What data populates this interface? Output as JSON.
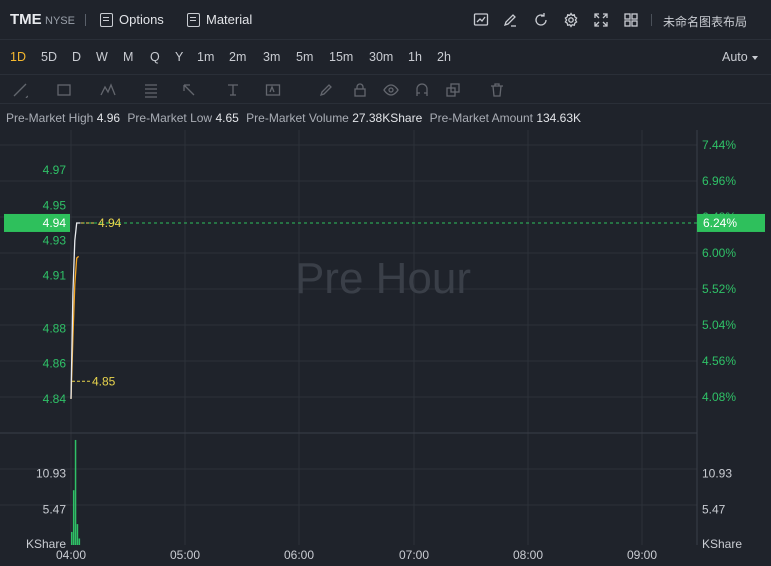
{
  "header": {
    "symbol": "TME",
    "exchange": "NYSE",
    "options_label": "Options",
    "material_label": "Material",
    "layout_name": "未命名图表布局"
  },
  "timeframes": [
    "1D",
    "5D",
    "D",
    "W",
    "M",
    "Q",
    "Y",
    "1m",
    "2m",
    "3m",
    "5m",
    "15m",
    "30m",
    "1h",
    "2h"
  ],
  "active_timeframe": "1D",
  "auto_label": "Auto",
  "icons": {
    "toolbar": [
      "chart-icon",
      "edit-icon",
      "refresh-icon",
      "gear-icon",
      "fullscreen-icon",
      "grid-layout-icon"
    ],
    "drawing": [
      "line-tool-icon",
      "rect-tool-icon",
      "pattern-tool-icon",
      "fib-tool-icon",
      "arrow-tool-icon",
      "measure-tool-icon",
      "text-tool-icon",
      "pencil-icon",
      "lock-icon",
      "eye-icon",
      "magnet-icon",
      "layers-icon",
      "trash-icon"
    ]
  },
  "premarket": {
    "high_label": "Pre-Market High",
    "high": "4.96",
    "low_label": "Pre-Market Low",
    "low": "4.65",
    "volume_label": "Pre-Market Volume",
    "volume": "27.38KShare",
    "amount_label": "Pre-Market Amount",
    "amount": "134.63K"
  },
  "colors": {
    "background": "#1f232b",
    "grid": "#2c313a",
    "up_green": "#2fc167",
    "highlight_green": "#2ec05c",
    "price_line": "#e8eaee",
    "avg_line": "#f5a623",
    "label_yellow": "#e8d44d"
  },
  "chart_data": {
    "type": "line",
    "watermark": "Pre Hour",
    "x_ticks": [
      "04:00",
      "05:00",
      "06:00",
      "07:00",
      "08:00",
      "09:00"
    ],
    "price_axis": {
      "ticks": [
        "4.97",
        "4.95",
        "4.93",
        "4.91",
        "4.88",
        "4.86",
        "4.84"
      ],
      "ylim": [
        4.828,
        4.99
      ]
    },
    "percent_axis": {
      "ticks": [
        "7.44%",
        "6.96%",
        "6.48%",
        "6.00%",
        "5.52%",
        "5.04%",
        "4.56%",
        "4.08%"
      ]
    },
    "current_price": 4.94,
    "current_price_label": "4.94",
    "current_percent_label": "6.24%",
    "low_marker": 4.85,
    "low_marker_label": "4.85",
    "high_marker_label": "4.94",
    "price_series": {
      "x": [
        "04:00",
        "04:01",
        "04:02",
        "04:03",
        "04:04",
        "04:05"
      ],
      "y": [
        4.84,
        4.9,
        4.93,
        4.94,
        4.94,
        4.94
      ]
    },
    "avg_series": {
      "x": [
        "04:00",
        "04:01",
        "04:02",
        "04:03",
        "04:04"
      ],
      "y": [
        4.84,
        4.875,
        4.905,
        4.92,
        4.921
      ]
    },
    "volume": {
      "unit": "KShare",
      "ticks": [
        "10.93",
        "5.47"
      ],
      "ylim": [
        0,
        16.4
      ],
      "bars": [
        2.0,
        8.4,
        16.1,
        3.2,
        1.0
      ]
    }
  }
}
